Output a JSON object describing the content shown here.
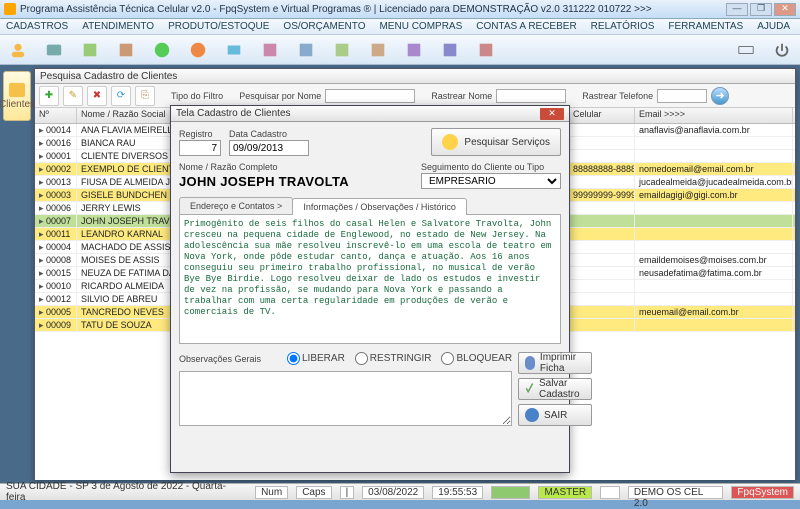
{
  "window": {
    "title": "Programa Assistência Técnica Celular v2.0 - FpqSystem e Virtual Programas ®  |  Licenciado para  DEMONSTRAÇÃO v2.0 311222 010722  >>>"
  },
  "menu": [
    "CADASTROS",
    "ATENDIMENTO",
    "PRODUTO/ESTOQUE",
    "OS/ORÇAMENTO",
    "MENU COMPRAS",
    "CONTAS A RECEBER",
    "RELATÓRIOS",
    "FERRAMENTAS",
    "AJUDA"
  ],
  "side": {
    "label": "Clientes"
  },
  "search": {
    "title": "Pesquisa Cadastro de Clientes",
    "filter_lbl": "Tipo do Filtro",
    "filter_val": "",
    "by_name": "Pesquisar por Nome",
    "by_name_val": "",
    "track_name": "Rastrear Nome",
    "track_name_val": "",
    "track_phone": "Rastrear Telefone",
    "track_phone_val": "",
    "cols": {
      "n": "Nº",
      "nm": "Nome / Razão Social",
      "cel": "Celular",
      "em": "Email >>>>"
    },
    "rows": [
      {
        "n": "00014",
        "nm": "ANA FLAVIA MEIRELLES",
        "cel": "",
        "em": "anaflavis@anaflavia.com.br",
        "hl": false
      },
      {
        "n": "00016",
        "nm": "BIANCA RAU",
        "cel": "",
        "em": "",
        "hl": false
      },
      {
        "n": "00001",
        "nm": "CLIENTE DIVERSOS",
        "cel": "",
        "em": "",
        "hl": false
      },
      {
        "n": "00002",
        "nm": "EXEMPLO DE CLIENTE",
        "cel": "88888888-8888",
        "em": "nomedoemail@email.com.br",
        "hl": true
      },
      {
        "n": "00013",
        "nm": "FIUSA DE ALMEIDA JUCA CHAVES",
        "cel": "",
        "em": "jucadealmeida@jucadealmeida.com.br",
        "hl": false
      },
      {
        "n": "00003",
        "nm": "GISELE BUNDCHEN",
        "cel": "99999999-9999",
        "em": "emaildagigi@gigi.com.br",
        "hl": true
      },
      {
        "n": "00006",
        "nm": "JERRY LEWIS",
        "cel": "",
        "em": "",
        "hl": false
      },
      {
        "n": "00007",
        "nm": "JOHN JOSEPH TRAVOLTA",
        "cel": "",
        "em": "",
        "hl": false,
        "sel": true
      },
      {
        "n": "00011",
        "nm": "LEANDRO KARNAL",
        "cel": "",
        "em": "",
        "hl": true
      },
      {
        "n": "00004",
        "nm": "MACHADO DE ASSIS",
        "cel": "",
        "em": "",
        "hl": false
      },
      {
        "n": "00008",
        "nm": "MOISES DE ASSIS",
        "cel": "",
        "em": "emaildemoises@moises.com.br",
        "hl": false
      },
      {
        "n": "00015",
        "nm": "NEUZA DE FATIMA DA SILVA",
        "cel": "",
        "em": "neusadefatima@fatima.com.br",
        "hl": false
      },
      {
        "n": "00010",
        "nm": "RICARDO ALMEIDA",
        "cel": "",
        "em": "",
        "hl": false
      },
      {
        "n": "00012",
        "nm": "SILVIO DE ABREU",
        "cel": "",
        "em": "",
        "hl": false
      },
      {
        "n": "00005",
        "nm": "TANCREDO NEVES",
        "cel": "",
        "em": "meuemail@email.com.br",
        "hl": true
      },
      {
        "n": "00009",
        "nm": "TATU DE SOUZA",
        "cel": "",
        "em": "",
        "hl": true
      }
    ]
  },
  "modal": {
    "title": "Tela Cadastro de Clientes",
    "reg_lbl": "Registro",
    "reg_val": "7",
    "date_lbl": "Data Cadastro",
    "date_val": "09/09/2013",
    "svc_btn": "Pesquisar Serviços",
    "name_lbl": "Nome / Razão Completo",
    "name_val": "JOHN JOSEPH TRAVOLTA",
    "seg_lbl": "Seguimento do Cliente ou Tipo",
    "seg_val": "EMPRESARIO",
    "tab1": "Endereço e Contatos >",
    "tab2": "Informações / Observações / Histórico",
    "obs": "Primogênito de seis filhos do casal Helen e Salvatore Travolta, John cresceu na pequena cidade de Englewood, no estado de New Jersey. Na adolescência sua mãe resolveu inscrevê-lo em uma escola de teatro em Nova York, onde pôde estudar canto, dança e atuação. Aos 16 anos conseguiu seu primeiro trabalho profissional, no musical de verão Bye Bye Birdie. Logo resolveu deixar de lado os estudos e investir de vez na profissão, se mudando para Nova York e passando a trabalhar com uma certa regularidade em produções de verão e comerciais de TV.",
    "obsg_lbl": "Observações Gerais",
    "r1": "LIBERAR",
    "r2": "RESTRINGIR",
    "r3": "BLOQUEAR",
    "b1": "Imprimir Ficha",
    "b2": "Salvar Cadastro",
    "b3": "SAIR"
  },
  "status": {
    "loc": "SUA CIDADE - SP  3 de Agosto de 2022 - Quarta-feira",
    "num": "Num",
    "caps": "Caps",
    "date": "03/08/2022",
    "time": "19:55:53",
    "master": "MASTER",
    "demo": "DEMO OS CEL 2.0",
    "brand": "FpqSystem"
  }
}
